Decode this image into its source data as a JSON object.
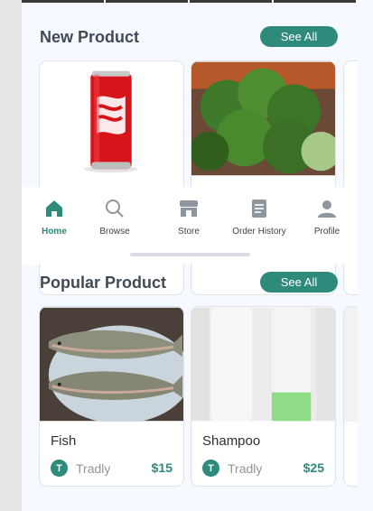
{
  "sections": {
    "new_product": {
      "title": "New Product",
      "see_all": "See All"
    },
    "popular_product": {
      "title": "Popular Product",
      "see_all": "See All"
    }
  },
  "new_products": [
    {
      "image": "coca-cola-can"
    },
    {
      "image": "broccoli"
    }
  ],
  "popular_products": [
    {
      "name": "Fish",
      "seller_initial": "T",
      "seller": "Tradly",
      "price": "$15",
      "image": "fish"
    },
    {
      "name": "Shampoo",
      "seller_initial": "T",
      "seller": "Tradly",
      "price": "$25",
      "image": "shampoo-bottles"
    }
  ],
  "navbar": {
    "items": [
      {
        "label": "Home",
        "icon": "home-icon",
        "active": true
      },
      {
        "label": "Browse",
        "icon": "search-icon",
        "active": false
      },
      {
        "label": "Store",
        "icon": "store-icon",
        "active": false
      },
      {
        "label": "Order History",
        "icon": "document-icon",
        "active": false
      },
      {
        "label": "Profile",
        "icon": "user-icon",
        "active": false
      }
    ]
  },
  "colors": {
    "accent": "#2e8a7a",
    "background": "#f6f9ff",
    "title": "#404b55"
  }
}
